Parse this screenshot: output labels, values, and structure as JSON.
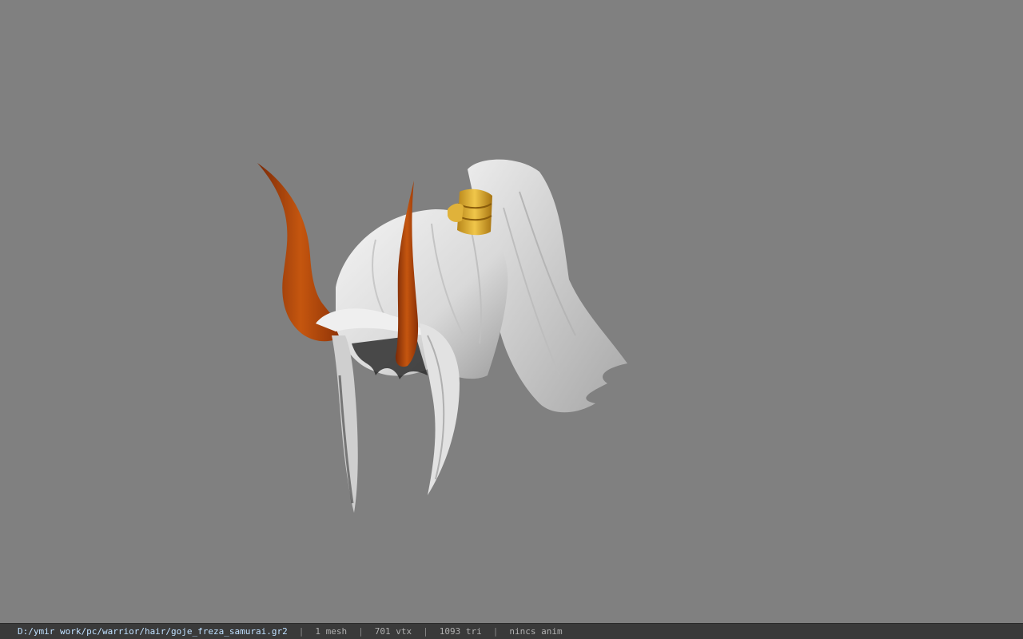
{
  "status_bar": {
    "file_path": "D:/ymir work/pc/warrior/hair/goje_freza_samurai.gr2",
    "separator": "|",
    "mesh_count": "1 mesh",
    "vertex_count": "701 vtx",
    "triangle_count": "1093 tri",
    "animation": "nincs anim"
  },
  "colors": {
    "background": "#808080",
    "status_bar": "#3a3a3a",
    "hair": "#e8e8e8",
    "horn": "#b84a0c",
    "hair_band": "#d4a12a"
  },
  "model": {
    "icon": "3d-model-hair-with-horns"
  }
}
